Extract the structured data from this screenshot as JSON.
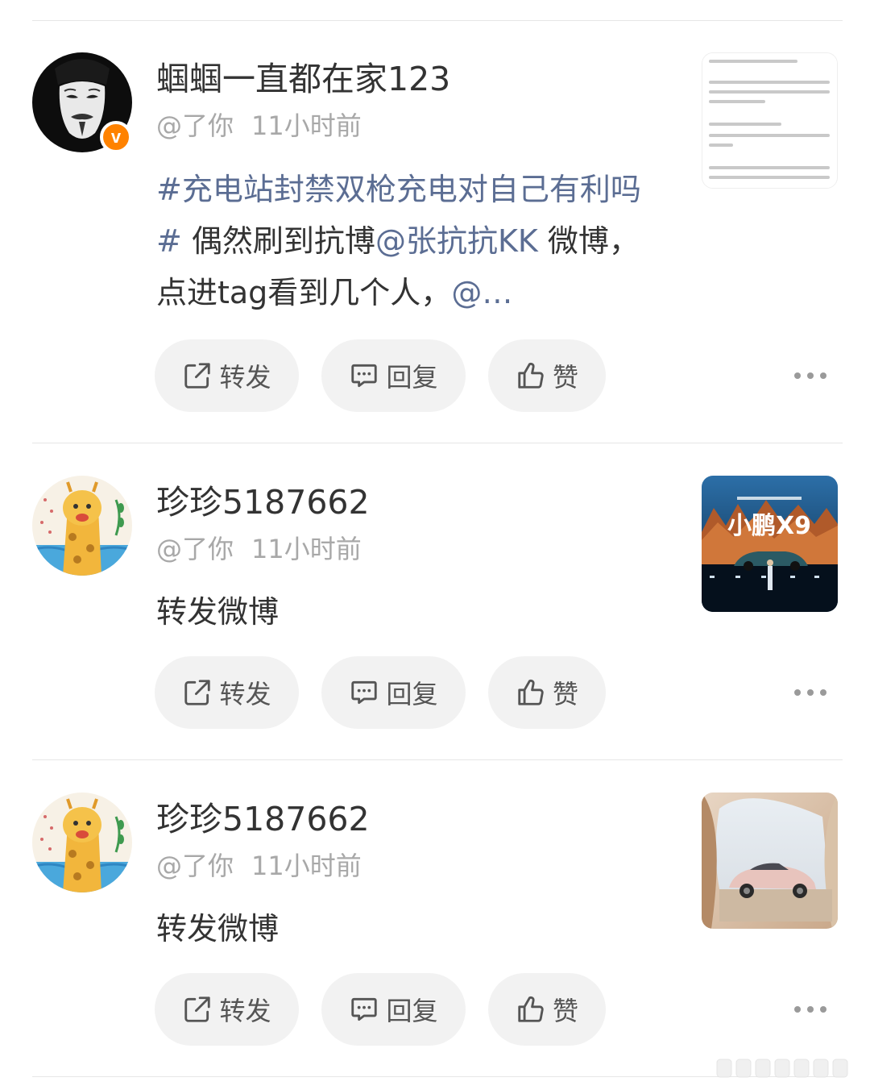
{
  "posts": [
    {
      "username": "蝈蝈一直都在家123",
      "handle": "@了你",
      "time": "11小时前",
      "verified": true,
      "verified_badge": "v",
      "topic": "#充电站封禁双枪充电对自己有利吗#",
      "text_a": " 偶然刷到抗博",
      "mention": "@张抗抗KK",
      "text_b": " 微博，点进tag看到几个人，",
      "mention_tail": "@…",
      "thumbnail_icon": "article-screenshot-thumbnail",
      "actions": {
        "repost": "转发",
        "reply": "回复",
        "like": "赞"
      }
    },
    {
      "username": "珍珍5187662",
      "handle": "@了你",
      "time": "11小时前",
      "verified": false,
      "text": "转发微博",
      "thumbnail_icon": "car-launch-event-thumbnail",
      "thumbnail_caption": "小鹏X9",
      "actions": {
        "repost": "转发",
        "reply": "回复",
        "like": "赞"
      }
    },
    {
      "username": "珍珍5187662",
      "handle": "@了你",
      "time": "11小时前",
      "verified": false,
      "text": "转发微博",
      "thumbnail_icon": "pink-car-thumbnail",
      "actions": {
        "repost": "转发",
        "reply": "回复",
        "like": "赞"
      }
    }
  ],
  "colors": {
    "link": "#5b6d93",
    "verified_badge": "#ff8200",
    "button_bg": "#f2f2f2",
    "meta_text": "#a8a8a8"
  }
}
